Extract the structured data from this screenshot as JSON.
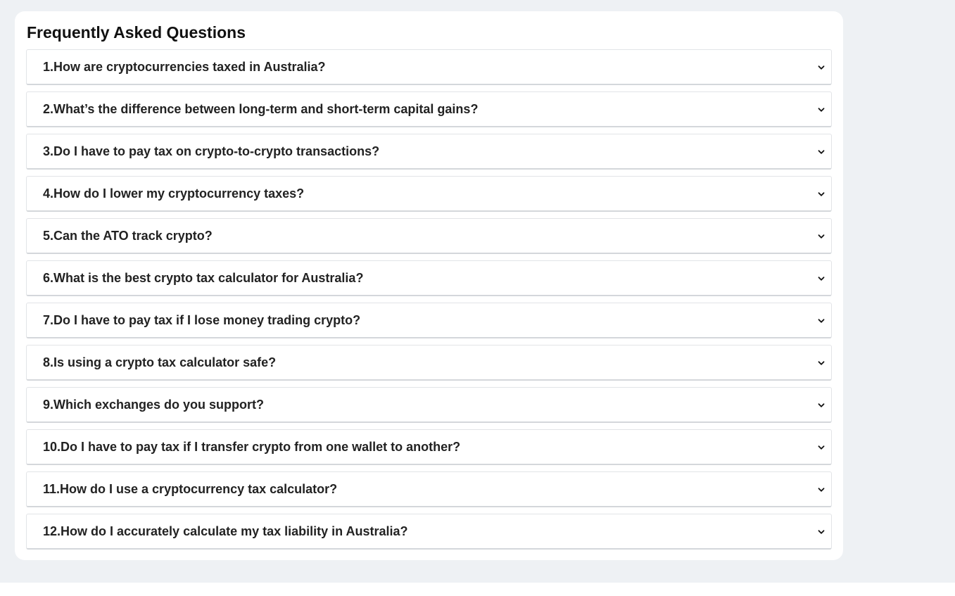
{
  "faq": {
    "title": "Frequently Asked Questions",
    "items": [
      {
        "question": "1.How are cryptocurrencies taxed in Australia?",
        "icon": "chevron-down-icon"
      },
      {
        "question": "2.What’s the difference between long-term and short-term capital gains?",
        "icon": "chevron-down-icon"
      },
      {
        "question": "3.Do I have to pay tax on crypto-to-crypto transactions?",
        "icon": "chevron-down-icon"
      },
      {
        "question": "4.How do I lower my cryptocurrency taxes?",
        "icon": "chevron-down-icon"
      },
      {
        "question": "5.Can the ATO track crypto?",
        "icon": "chevron-down-icon"
      },
      {
        "question": "6.What is the best crypto tax calculator for Australia?",
        "icon": "chevron-down-icon"
      },
      {
        "question": "7.Do I have to pay tax if I lose money trading crypto?",
        "icon": "chevron-down-icon"
      },
      {
        "question": "8.Is using a crypto tax calculator safe?",
        "icon": "chevron-down-icon"
      },
      {
        "question": "9.Which exchanges do you support?",
        "icon": "chevron-down-icon"
      },
      {
        "question": "10.Do I have to pay tax if I transfer crypto from one wallet to another?",
        "icon": "chevron-down-icon"
      },
      {
        "question": "11.How do I use a cryptocurrency tax calculator?",
        "icon": "chevron-down-icon"
      },
      {
        "question": "12.How do I accurately calculate my tax liability in Australia?",
        "icon": "chevron-down-icon"
      }
    ]
  },
  "colors": {
    "page_background": "#eef1f4",
    "card_background": "#ffffff",
    "text": "#222222"
  }
}
